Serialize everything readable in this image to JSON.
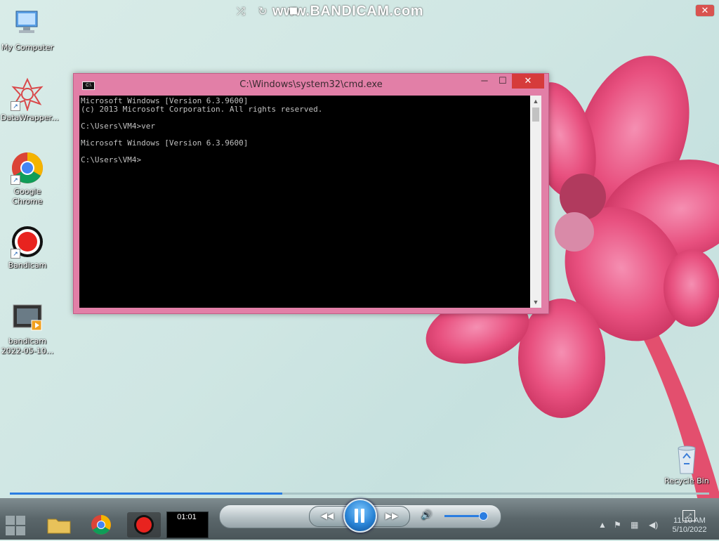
{
  "watermark": {
    "text": "www.BANDICAM.com",
    "close_symbol": "✕"
  },
  "desktop": {
    "icons": [
      {
        "label": "My Computer",
        "icon": "computer-icon"
      },
      {
        "label": "DataWrapper...",
        "icon": "app-shortcut-icon"
      },
      {
        "label": "Google Chrome",
        "icon": "chrome-icon"
      },
      {
        "label": "Bandicam",
        "icon": "bandicam-icon"
      },
      {
        "label": "bandicam 2022-05-10...",
        "icon": "video-file-icon"
      }
    ],
    "recycle_bin": {
      "label": "Recycle Bin",
      "icon": "recycle-bin-icon"
    }
  },
  "cmd_window": {
    "title": "C:\\Windows\\system32\\cmd.exe",
    "minimize": "─",
    "maximize": "☐",
    "close": "✕",
    "lines": [
      "Microsoft Windows [Version 6.3.9600]",
      "(c) 2013 Microsoft Corporation. All rights reserved.",
      "",
      "C:\\Users\\VM4>ver",
      "",
      "Microsoft Windows [Version 6.3.9600]",
      "",
      "C:\\Users\\VM4>"
    ]
  },
  "player": {
    "progress": 0.39,
    "volume": 0.9,
    "time": "01:01",
    "buttons": {
      "shuffle": "⤮",
      "repeat": "↻",
      "stop": "■",
      "previous": "◀◀",
      "next": "▶▶",
      "volume": "🔊"
    }
  },
  "taskbar": {
    "clock_time": "11:10 AM",
    "clock_date": "5/10/2022"
  },
  "colors": {
    "cmd_frame": "#e27fa7",
    "close_red": "#d63b3b",
    "accent_blue": "#2a7de1"
  }
}
